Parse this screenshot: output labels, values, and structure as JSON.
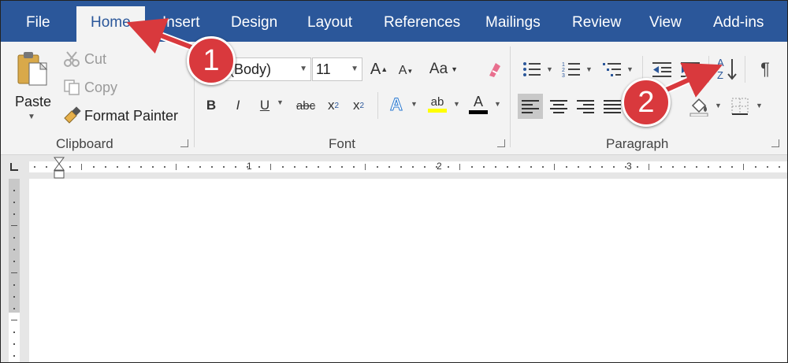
{
  "tabs": [
    {
      "label": "File",
      "active": false
    },
    {
      "label": "Home",
      "active": true
    },
    {
      "label": "Insert",
      "active": false
    },
    {
      "label": "Design",
      "active": false
    },
    {
      "label": "Layout",
      "active": false
    },
    {
      "label": "References",
      "active": false
    },
    {
      "label": "Mailings",
      "active": false
    },
    {
      "label": "Review",
      "active": false
    },
    {
      "label": "View",
      "active": false
    },
    {
      "label": "Add-ins",
      "active": false
    }
  ],
  "clipboard": {
    "paste_label": "Paste",
    "cut_label": "Cut",
    "copy_label": "Copy",
    "format_painter_label": "Format Painter",
    "group_label": "Clipboard"
  },
  "font": {
    "font_name": "ri (Body)",
    "font_size": "11",
    "change_case_label": "Aa",
    "bold": "B",
    "italic": "I",
    "underline": "U",
    "strike": "abc",
    "subscript": "x",
    "subscript_mark": "2",
    "superscript": "x",
    "superscript_mark": "2",
    "grow": "A",
    "shrink": "A",
    "text_effects": "A",
    "font_color": "A",
    "highlight": "ab",
    "group_label": "Font"
  },
  "paragraph": {
    "pilcrow": "¶",
    "group_label": "Paragraph"
  },
  "ruler": {
    "marks": [
      "1",
      "2",
      "3"
    ]
  },
  "callouts": {
    "one": "1",
    "two": "2"
  },
  "colors": {
    "tab_bar": "#2b579a",
    "ribbon": "#f3f3f3",
    "callout": "#d9393d",
    "highlight": "#ffff00",
    "font_color": "#000000"
  }
}
